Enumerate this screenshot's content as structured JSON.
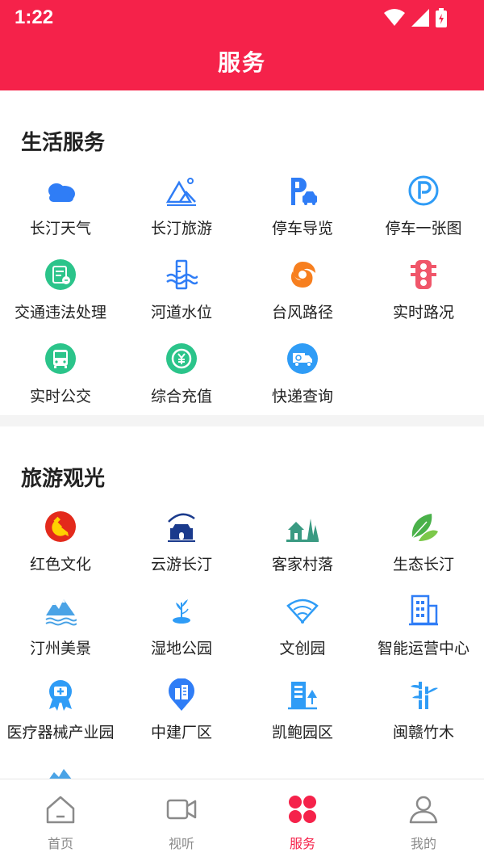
{
  "status_bar": {
    "time": "1:22"
  },
  "header": {
    "title": "服务"
  },
  "sections": [
    {
      "title": "生活服务",
      "items": [
        {
          "label": "长汀天气",
          "icon": "cloud-icon"
        },
        {
          "label": "长汀旅游",
          "icon": "mountain-icon"
        },
        {
          "label": "停车导览",
          "icon": "parking-car-icon"
        },
        {
          "label": "停车一张图",
          "icon": "parking-circle-icon"
        },
        {
          "label": "交通违法处理",
          "icon": "traffic-ticket-icon"
        },
        {
          "label": "河道水位",
          "icon": "water-level-icon"
        },
        {
          "label": "台风路径",
          "icon": "typhoon-icon"
        },
        {
          "label": "实时路况",
          "icon": "traffic-light-icon"
        },
        {
          "label": "实时公交",
          "icon": "bus-icon"
        },
        {
          "label": "综合充值",
          "icon": "recharge-icon"
        },
        {
          "label": "快递查询",
          "icon": "delivery-truck-icon"
        }
      ]
    },
    {
      "title": "旅游观光",
      "items": [
        {
          "label": "红色文化",
          "icon": "party-emblem-icon"
        },
        {
          "label": "云游长汀",
          "icon": "city-gate-icon"
        },
        {
          "label": "客家村落",
          "icon": "village-icon"
        },
        {
          "label": "生态长汀",
          "icon": "leaves-icon"
        },
        {
          "label": "汀州美景",
          "icon": "scenery-icon"
        },
        {
          "label": "湿地公园",
          "icon": "wetland-icon"
        },
        {
          "label": "文创园",
          "icon": "fan-icon"
        },
        {
          "label": "智能运营中心",
          "icon": "building-icon"
        },
        {
          "label": "医疗器械产业园",
          "icon": "medical-badge-icon"
        },
        {
          "label": "中建厂区",
          "icon": "factory-pin-icon"
        },
        {
          "label": "凯鲍园区",
          "icon": "park-building-icon"
        },
        {
          "label": "闽赣竹木",
          "icon": "bamboo-icon"
        }
      ]
    }
  ],
  "bottom_nav": [
    {
      "label": "首页",
      "icon": "home-icon",
      "active": false
    },
    {
      "label": "视听",
      "icon": "video-camera-icon",
      "active": false
    },
    {
      "label": "服务",
      "icon": "services-grid-icon",
      "active": true
    },
    {
      "label": "我的",
      "icon": "profile-icon",
      "active": false
    }
  ],
  "colors": {
    "brand": "#f5224a",
    "icon_blue": "#2f7df6",
    "icon_green": "#2bc48a",
    "icon_orange": "#f77f1f",
    "icon_red": "#f0566a"
  }
}
